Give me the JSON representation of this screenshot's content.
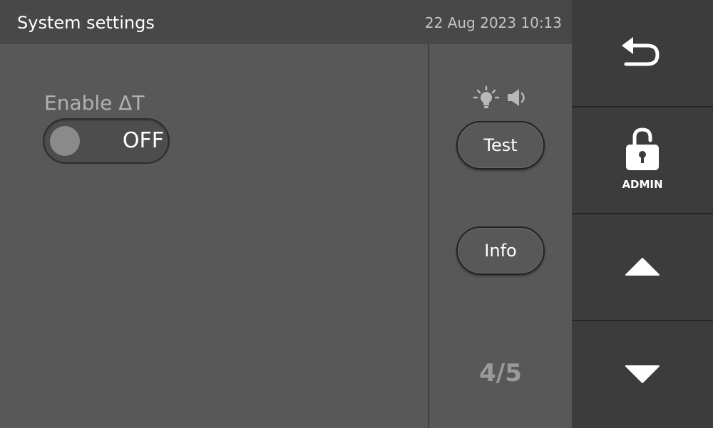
{
  "header": {
    "title": "System settings",
    "datetime": "22 Aug 2023 10:13"
  },
  "main": {
    "toggle": {
      "label": "Enable ΔT",
      "state_text": "OFF",
      "value": false
    }
  },
  "side": {
    "indicator_icons": [
      "light-bulb-icon",
      "speaker-icon"
    ],
    "test_label": "Test",
    "info_label": "Info",
    "page_indicator": "4/5"
  },
  "nav": {
    "back_icon": "back-arrow-icon",
    "lock_icon": "padlock-icon",
    "admin_label": "ADMIN",
    "up_icon": "triangle-up-icon",
    "down_icon": "triangle-down-icon"
  },
  "colors": {
    "background": "#585858",
    "header": "#484848",
    "nav": "#3c3c3c",
    "text": "#ffffff",
    "muted_text": "#b0b0b0"
  }
}
